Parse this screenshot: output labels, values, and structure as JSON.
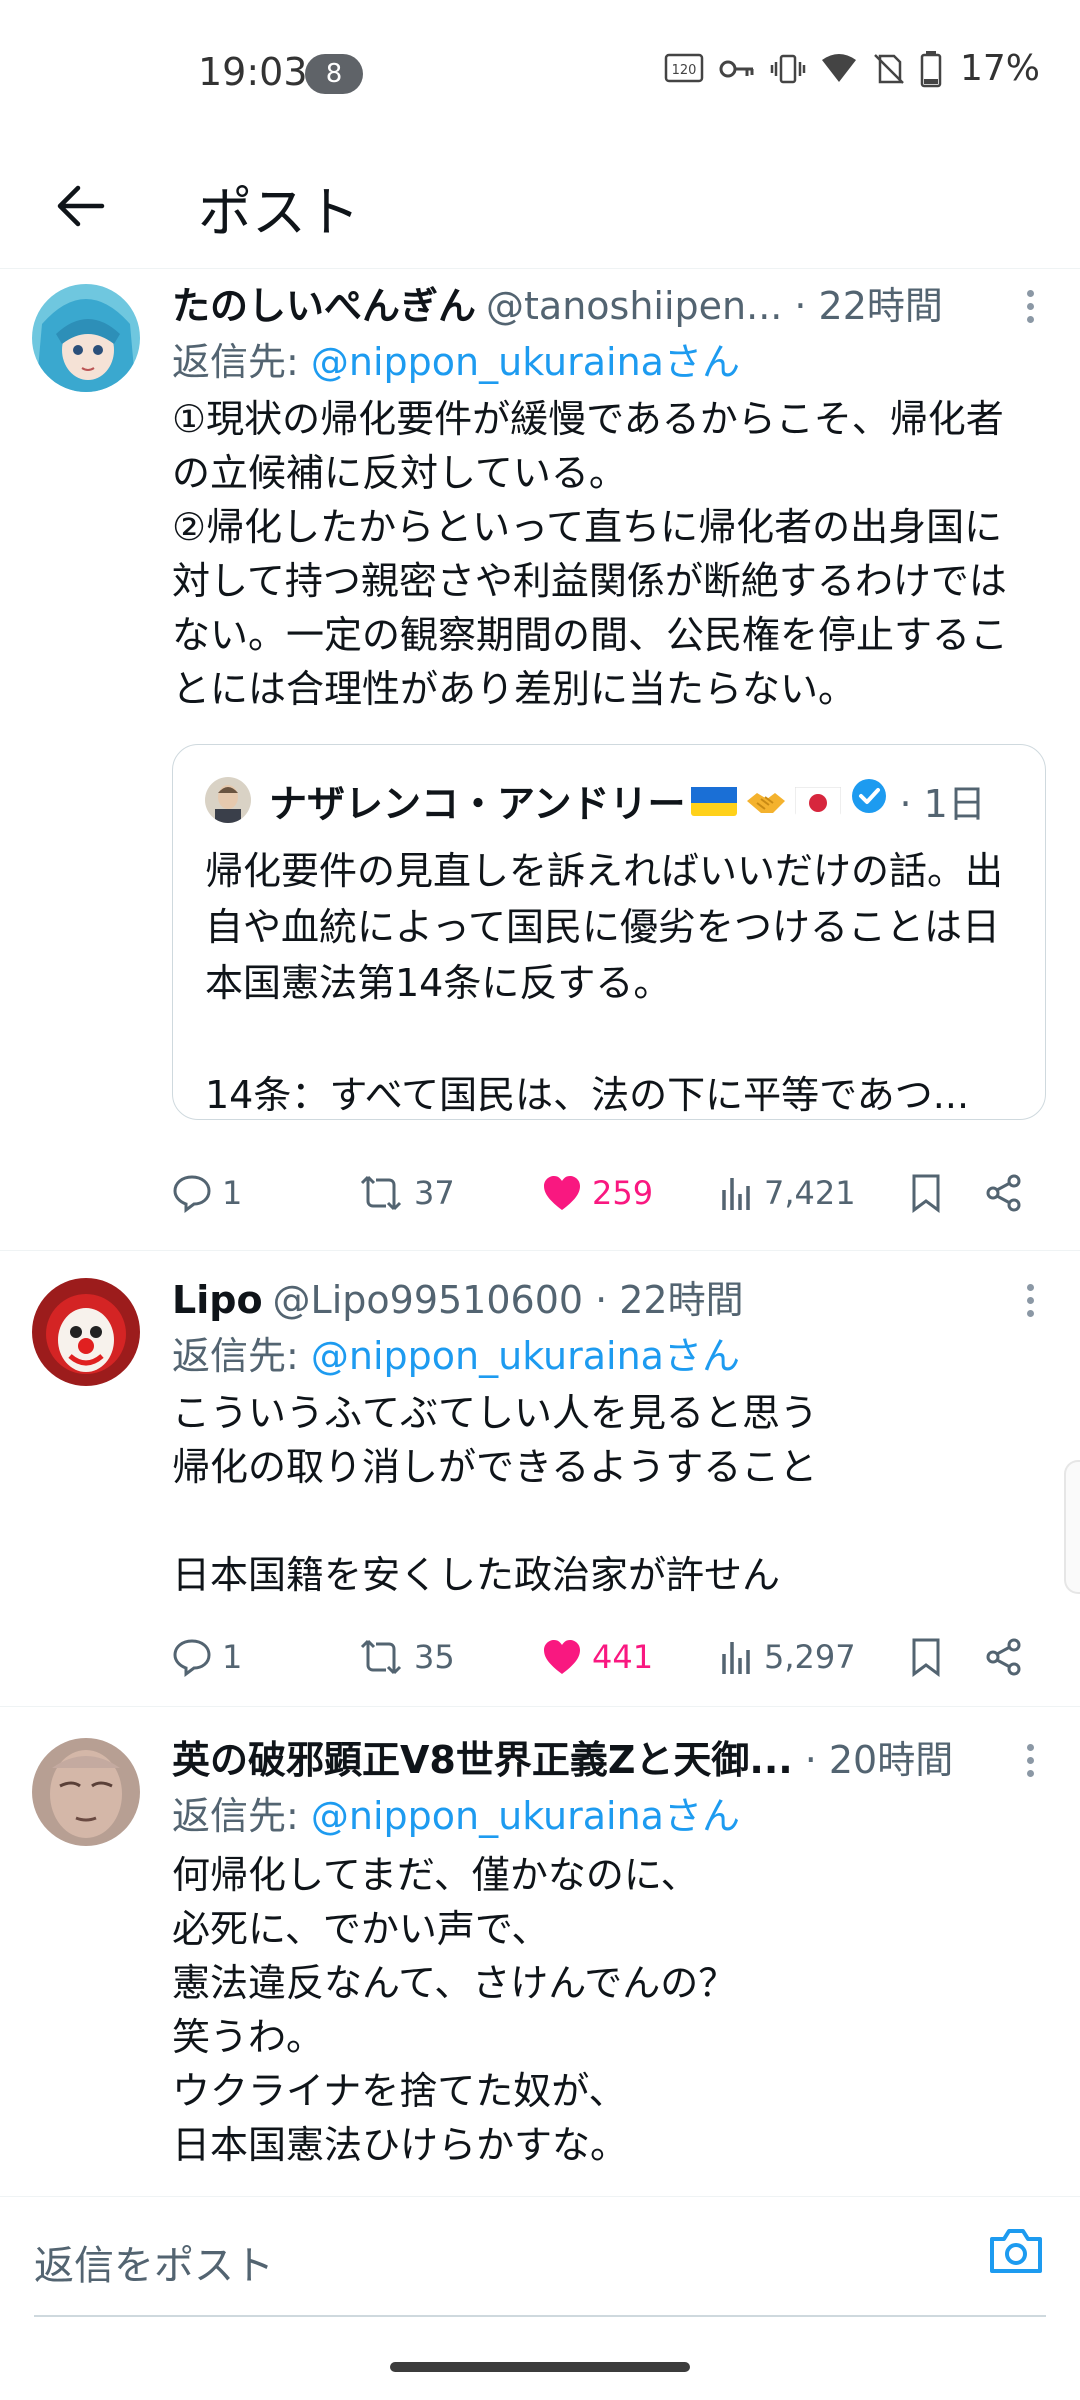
{
  "status_bar": {
    "time": "19:03",
    "notification_count": "8",
    "battery": "17%"
  },
  "header": {
    "title": "ポスト"
  },
  "tweets": [
    {
      "display_name": "たのしいぺんぎん",
      "handle": "@tanoshiipen...",
      "time": "· 22時間",
      "reply_prefix": "返信先: ",
      "reply_handle": "@nippon_ukurainaさん",
      "text": "①現状の帰化要件が緩慢であるからこそ、帰化者の立候補に反対している。\n②帰化したからといって直ちに帰化者の出身国に対して持つ親密さや利益関係が断絶するわけではない。一定の観察期間の間、公民権を停止することには合理性があり差別に当たらない。",
      "quote": {
        "display_name": "ナザレンコ・アンドリー",
        "time": "· 1日",
        "text": "帰化要件の見直しを訴えればいいだけの話。出自や血統によって国民に優劣をつけることは日本国憲法第14条に反する。\n\n14条：すべて国民は、法の下に平等であつ..."
      },
      "replies": "1",
      "retweets": "37",
      "likes": "259",
      "views": "7,421"
    },
    {
      "display_name": "Lipo",
      "handle": "@Lipo99510600",
      "time": "· 22時間",
      "reply_prefix": "返信先: ",
      "reply_handle": "@nippon_ukurainaさん",
      "text": "こういうふてぶてしい人を見ると思う\n帰化の取り消しができるようすること\n\n日本国籍を安くした政治家が許せん",
      "replies": "1",
      "retweets": "35",
      "likes": "441",
      "views": "5,297"
    },
    {
      "display_name": "英の破邪顕正V8世界正義Zと天御...",
      "time": "· 20時間",
      "reply_prefix": "返信先: ",
      "reply_handle": "@nippon_ukurainaさん",
      "text": "何帰化してまだ、僅かなのに、\n必死に、でかい声で、\n憲法違反なんて、さけんでんの？\n笑うわ。\nウクライナを捨てた奴が、\n日本国憲法ひけらかすな。"
    }
  ],
  "reply_bar": {
    "placeholder": "返信をポスト"
  },
  "colors": {
    "accent": "#1d9bf0",
    "like": "#f91880",
    "muted": "#536471"
  }
}
